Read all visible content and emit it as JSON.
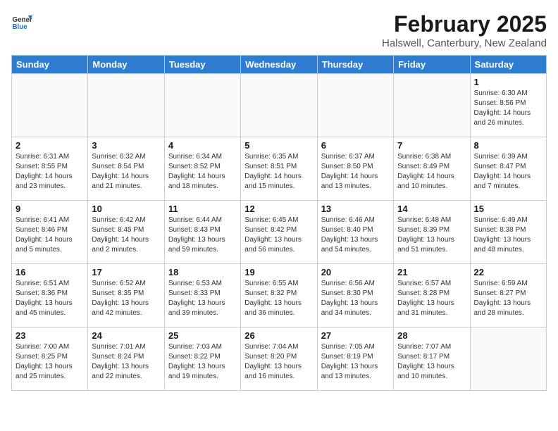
{
  "header": {
    "logo_general": "General",
    "logo_blue": "Blue",
    "title": "February 2025",
    "subtitle": "Halswell, Canterbury, New Zealand"
  },
  "weekdays": [
    "Sunday",
    "Monday",
    "Tuesday",
    "Wednesday",
    "Thursday",
    "Friday",
    "Saturday"
  ],
  "weeks": [
    [
      {
        "day": "",
        "info": ""
      },
      {
        "day": "",
        "info": ""
      },
      {
        "day": "",
        "info": ""
      },
      {
        "day": "",
        "info": ""
      },
      {
        "day": "",
        "info": ""
      },
      {
        "day": "",
        "info": ""
      },
      {
        "day": "1",
        "info": "Sunrise: 6:30 AM\nSunset: 8:56 PM\nDaylight: 14 hours and 26 minutes."
      }
    ],
    [
      {
        "day": "2",
        "info": "Sunrise: 6:31 AM\nSunset: 8:55 PM\nDaylight: 14 hours and 23 minutes."
      },
      {
        "day": "3",
        "info": "Sunrise: 6:32 AM\nSunset: 8:54 PM\nDaylight: 14 hours and 21 minutes."
      },
      {
        "day": "4",
        "info": "Sunrise: 6:34 AM\nSunset: 8:52 PM\nDaylight: 14 hours and 18 minutes."
      },
      {
        "day": "5",
        "info": "Sunrise: 6:35 AM\nSunset: 8:51 PM\nDaylight: 14 hours and 15 minutes."
      },
      {
        "day": "6",
        "info": "Sunrise: 6:37 AM\nSunset: 8:50 PM\nDaylight: 14 hours and 13 minutes."
      },
      {
        "day": "7",
        "info": "Sunrise: 6:38 AM\nSunset: 8:49 PM\nDaylight: 14 hours and 10 minutes."
      },
      {
        "day": "8",
        "info": "Sunrise: 6:39 AM\nSunset: 8:47 PM\nDaylight: 14 hours and 7 minutes."
      }
    ],
    [
      {
        "day": "9",
        "info": "Sunrise: 6:41 AM\nSunset: 8:46 PM\nDaylight: 14 hours and 5 minutes."
      },
      {
        "day": "10",
        "info": "Sunrise: 6:42 AM\nSunset: 8:45 PM\nDaylight: 14 hours and 2 minutes."
      },
      {
        "day": "11",
        "info": "Sunrise: 6:44 AM\nSunset: 8:43 PM\nDaylight: 13 hours and 59 minutes."
      },
      {
        "day": "12",
        "info": "Sunrise: 6:45 AM\nSunset: 8:42 PM\nDaylight: 13 hours and 56 minutes."
      },
      {
        "day": "13",
        "info": "Sunrise: 6:46 AM\nSunset: 8:40 PM\nDaylight: 13 hours and 54 minutes."
      },
      {
        "day": "14",
        "info": "Sunrise: 6:48 AM\nSunset: 8:39 PM\nDaylight: 13 hours and 51 minutes."
      },
      {
        "day": "15",
        "info": "Sunrise: 6:49 AM\nSunset: 8:38 PM\nDaylight: 13 hours and 48 minutes."
      }
    ],
    [
      {
        "day": "16",
        "info": "Sunrise: 6:51 AM\nSunset: 8:36 PM\nDaylight: 13 hours and 45 minutes."
      },
      {
        "day": "17",
        "info": "Sunrise: 6:52 AM\nSunset: 8:35 PM\nDaylight: 13 hours and 42 minutes."
      },
      {
        "day": "18",
        "info": "Sunrise: 6:53 AM\nSunset: 8:33 PM\nDaylight: 13 hours and 39 minutes."
      },
      {
        "day": "19",
        "info": "Sunrise: 6:55 AM\nSunset: 8:32 PM\nDaylight: 13 hours and 36 minutes."
      },
      {
        "day": "20",
        "info": "Sunrise: 6:56 AM\nSunset: 8:30 PM\nDaylight: 13 hours and 34 minutes."
      },
      {
        "day": "21",
        "info": "Sunrise: 6:57 AM\nSunset: 8:28 PM\nDaylight: 13 hours and 31 minutes."
      },
      {
        "day": "22",
        "info": "Sunrise: 6:59 AM\nSunset: 8:27 PM\nDaylight: 13 hours and 28 minutes."
      }
    ],
    [
      {
        "day": "23",
        "info": "Sunrise: 7:00 AM\nSunset: 8:25 PM\nDaylight: 13 hours and 25 minutes."
      },
      {
        "day": "24",
        "info": "Sunrise: 7:01 AM\nSunset: 8:24 PM\nDaylight: 13 hours and 22 minutes."
      },
      {
        "day": "25",
        "info": "Sunrise: 7:03 AM\nSunset: 8:22 PM\nDaylight: 13 hours and 19 minutes."
      },
      {
        "day": "26",
        "info": "Sunrise: 7:04 AM\nSunset: 8:20 PM\nDaylight: 13 hours and 16 minutes."
      },
      {
        "day": "27",
        "info": "Sunrise: 7:05 AM\nSunset: 8:19 PM\nDaylight: 13 hours and 13 minutes."
      },
      {
        "day": "28",
        "info": "Sunrise: 7:07 AM\nSunset: 8:17 PM\nDaylight: 13 hours and 10 minutes."
      },
      {
        "day": "",
        "info": ""
      }
    ]
  ]
}
